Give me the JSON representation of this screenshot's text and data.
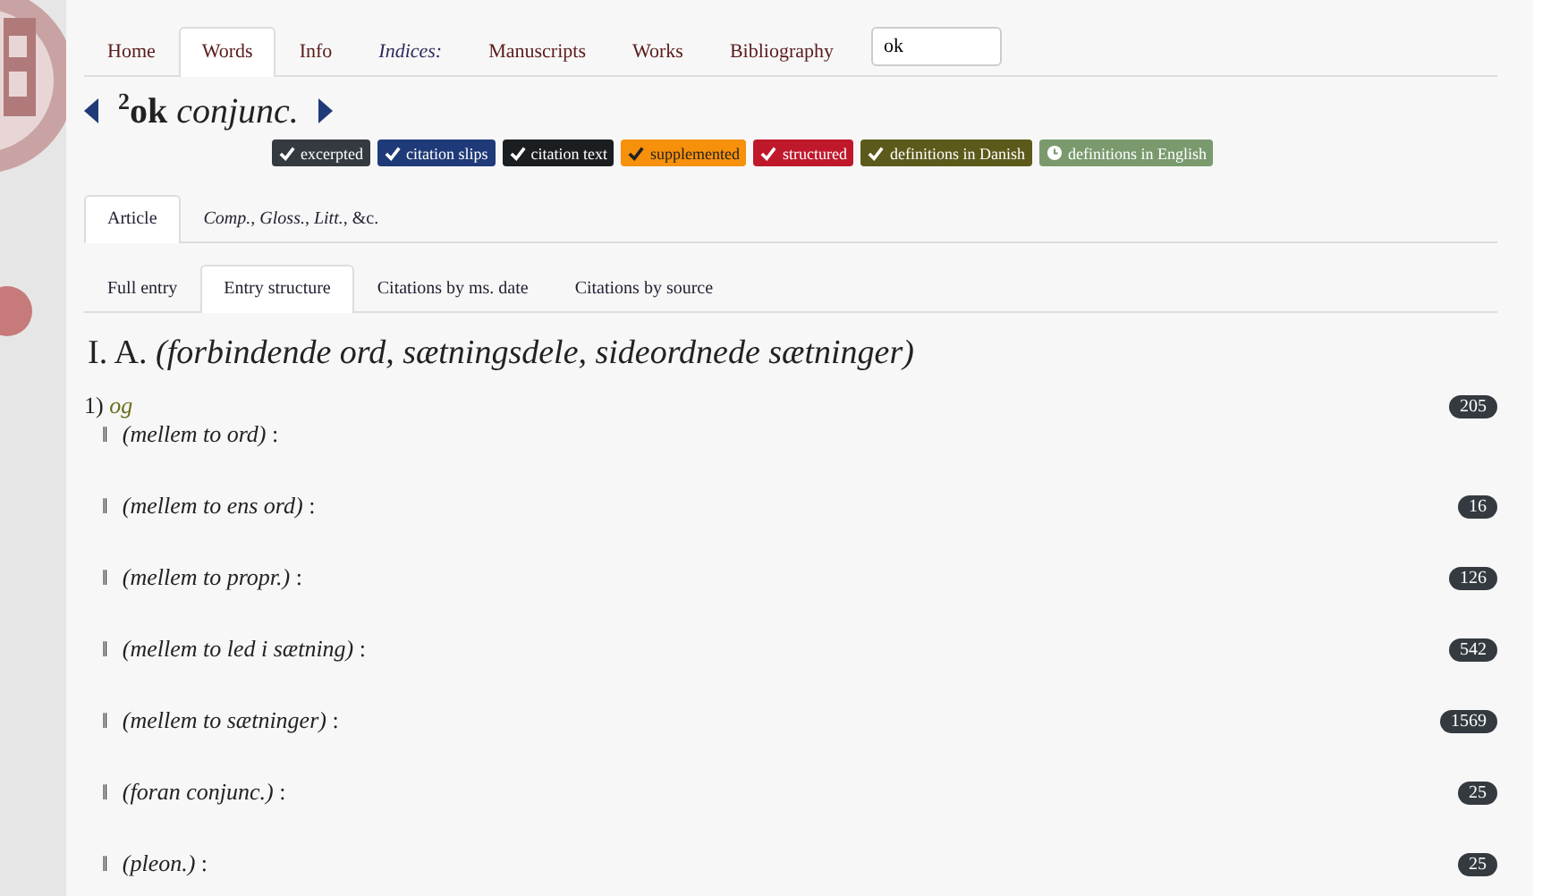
{
  "nav": {
    "items": [
      {
        "label": "Home",
        "selected": false,
        "kind": "link"
      },
      {
        "label": "Words",
        "selected": true,
        "kind": "link"
      },
      {
        "label": "Info",
        "selected": false,
        "kind": "link"
      },
      {
        "label": "Indices:",
        "selected": false,
        "kind": "label"
      },
      {
        "label": "Manuscripts",
        "selected": false,
        "kind": "link"
      },
      {
        "label": "Works",
        "selected": false,
        "kind": "link"
      },
      {
        "label": "Bibliography",
        "selected": false,
        "kind": "link"
      }
    ],
    "search": {
      "value": "ok"
    }
  },
  "entry": {
    "homograph": "2",
    "headword": "ok",
    "pos": "conjunc."
  },
  "badges": [
    {
      "label": "excerpted",
      "color": "#343a40",
      "kind": "done"
    },
    {
      "label": "citation slips",
      "color": "#1f3a78",
      "kind": "done"
    },
    {
      "label": "citation text",
      "color": "#1b1e21",
      "kind": "done"
    },
    {
      "label": "supplemented",
      "color": "#f7900a",
      "kind": "done"
    },
    {
      "label": "structured",
      "color": "#c0182b",
      "kind": "done"
    },
    {
      "label": "definitions in Danish",
      "color": "#5b5a1a",
      "kind": "done"
    },
    {
      "label": "definitions in English",
      "color": "#7a9a6e",
      "kind": "pending"
    }
  ],
  "article_tabs": [
    {
      "label": "Article",
      "selected": true
    },
    {
      "label": "*Comp.*, *Gloss.*, *Litt.*, &c.",
      "selected": false
    }
  ],
  "view_tabs": [
    {
      "label": "Full entry",
      "selected": false
    },
    {
      "label": "Entry structure",
      "selected": true
    },
    {
      "label": "Citations by ms. date",
      "selected": false
    },
    {
      "label": "Citations by source",
      "selected": false
    }
  ],
  "section": {
    "heading": "I. A. *(forbindende ord, sætningsdele, sideordnede sætninger)*",
    "senses": [
      {
        "number": "1)",
        "gloss": "og",
        "count": "205",
        "children": [
          {
            "marker": "‖",
            "text": "*(mellem to ord)* :"
          },
          {
            "marker": "‖",
            "text": "*(mellem to ens ord)* :",
            "count": "16"
          },
          {
            "marker": "‖",
            "text": "*(mellem to propr.)* :",
            "count": "126"
          },
          {
            "marker": "‖",
            "text": "*(mellem to led i sætning)* :",
            "count": "542"
          },
          {
            "marker": "‖",
            "text": "*(mellem to sætninger)* :",
            "count": "1569"
          },
          {
            "marker": "‖",
            "text": "*(foran conjunc.)* :",
            "count": "25"
          },
          {
            "marker": "‖",
            "text": "*(pleon.)* :",
            "count": "25"
          }
        ]
      }
    ]
  }
}
